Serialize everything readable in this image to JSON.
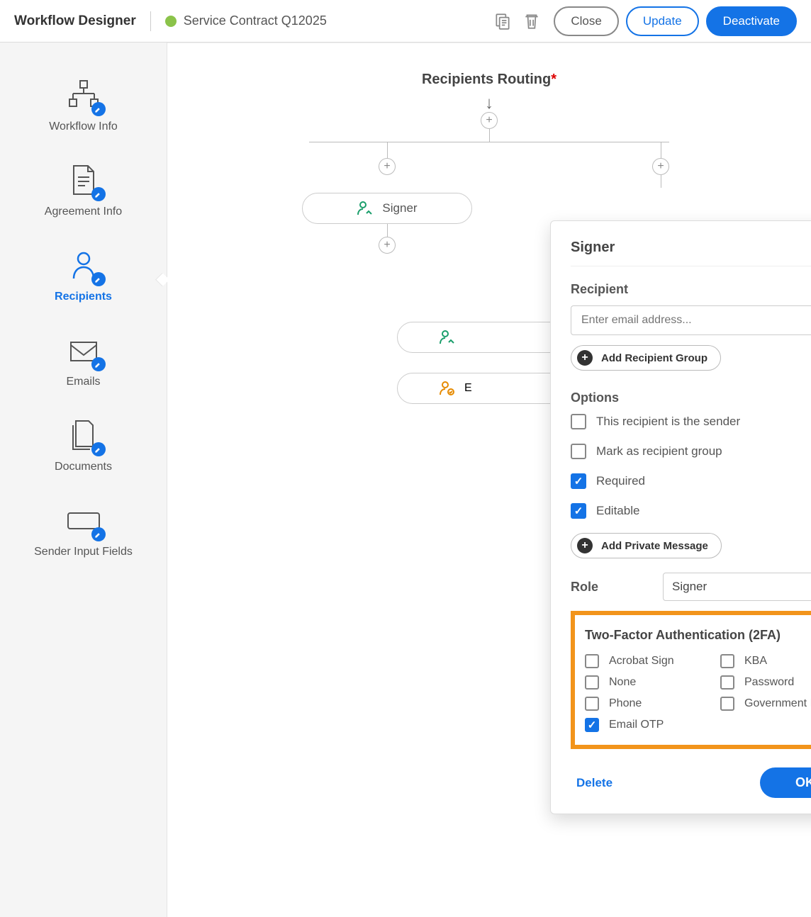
{
  "header": {
    "title": "Workflow Designer",
    "workflow_name": "Service Contract Q12025",
    "close": "Close",
    "update": "Update",
    "deactivate": "Deactivate"
  },
  "sidebar": {
    "items": [
      {
        "label": "Workflow Info"
      },
      {
        "label": "Agreement Info"
      },
      {
        "label": "Recipients"
      },
      {
        "label": "Emails"
      },
      {
        "label": "Documents"
      },
      {
        "label": "Sender Input Fields"
      }
    ]
  },
  "canvas": {
    "routing_title": "Recipients Routing",
    "required_mark": "*",
    "node_signer": "Signer",
    "node_ex_prefix": "E"
  },
  "popover": {
    "title": "Signer",
    "recipient_label": "Recipient",
    "email_placeholder": "Enter email address...",
    "add_group": "Add Recipient Group",
    "options_label": "Options",
    "checkboxes": {
      "is_sender": {
        "label": "This recipient is the sender",
        "checked": false
      },
      "mark_group": {
        "label": "Mark as recipient group",
        "checked": false
      },
      "required": {
        "label": "Required",
        "checked": true
      },
      "editable": {
        "label": "Editable",
        "checked": true
      }
    },
    "add_private": "Add Private Message",
    "role_label": "Role",
    "role_value": "Signer",
    "tfa_title": "Two-Factor Authentication (2FA)",
    "tfa": [
      {
        "label": "Acrobat Sign",
        "checked": false
      },
      {
        "label": "KBA",
        "checked": false
      },
      {
        "label": "None",
        "checked": false
      },
      {
        "label": "Password",
        "checked": false
      },
      {
        "label": "Phone",
        "checked": false
      },
      {
        "label": "Government ID",
        "checked": false
      },
      {
        "label": "Email OTP",
        "checked": true
      }
    ],
    "delete": "Delete",
    "ok": "OK"
  }
}
